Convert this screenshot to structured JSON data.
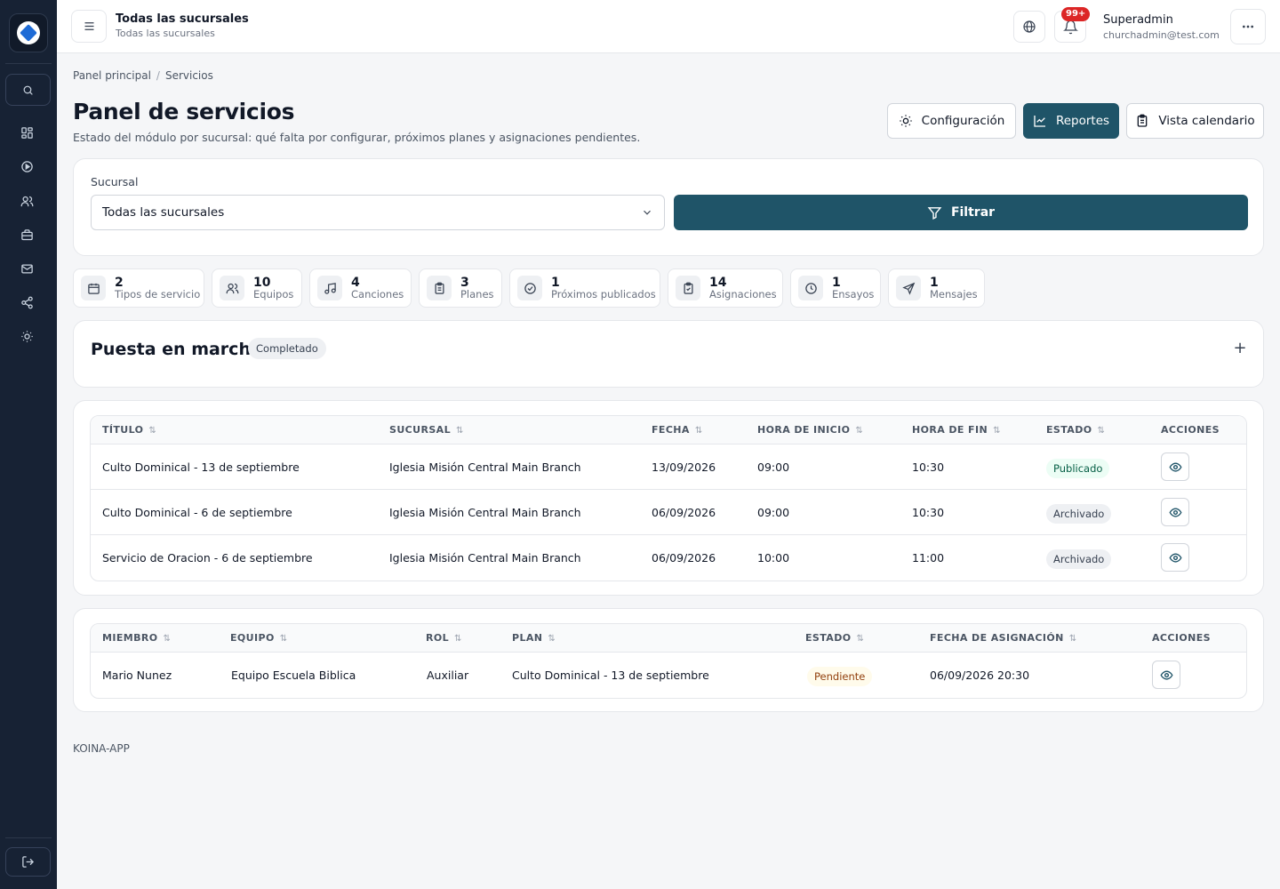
{
  "app": {
    "footer": "KOINA-APP"
  },
  "topbar": {
    "title": "Todas las sucursales",
    "subtitle": "Todas las sucursales",
    "notifications_badge": "99+",
    "user_name": "Superadmin",
    "user_email": "churchadmin@test.com"
  },
  "breadcrumb": {
    "home": "Panel principal",
    "current": "Servicios"
  },
  "header": {
    "title": "Panel de servicios",
    "description": "Estado del módulo por sucursal: qué falta por configurar, próximos planes y asignaciones pendientes.",
    "config_label": "Configuración",
    "reports_label": "Reportes",
    "calendar_label": "Vista calendario"
  },
  "filter": {
    "label": "Sucursal",
    "selected": "Todas las sucursales",
    "button_label": "Filtrar"
  },
  "stats": [
    {
      "value": "2",
      "label": "Tipos de servicio",
      "icon": "calendar-icon"
    },
    {
      "value": "10",
      "label": "Equipos",
      "icon": "users-icon"
    },
    {
      "value": "4",
      "label": "Canciones",
      "icon": "music-icon"
    },
    {
      "value": "3",
      "label": "Planes",
      "icon": "clipboard-icon"
    },
    {
      "value": "1",
      "label": "Próximos publicados",
      "icon": "check-circle-icon"
    },
    {
      "value": "14",
      "label": "Asignaciones",
      "icon": "clipboard-check-icon"
    },
    {
      "value": "1",
      "label": "Ensayos",
      "icon": "clock-icon"
    },
    {
      "value": "1",
      "label": "Mensajes",
      "icon": "send-icon"
    }
  ],
  "setup": {
    "title": "Puesta en marcha",
    "status": "Completado",
    "toggle": "+"
  },
  "plans_table": {
    "columns": [
      "TÍTULO",
      "SUCURSAL",
      "FECHA",
      "HORA DE INICIO",
      "HORA DE FIN",
      "ESTADO",
      "ACCIONES"
    ],
    "rows": [
      {
        "title": "Culto Dominical - 13 de septiembre",
        "branch": "Iglesia Misión Central Main Branch",
        "date": "13/09/2026",
        "start": "09:00",
        "end": "10:30",
        "status": "Publicado"
      },
      {
        "title": "Culto Dominical - 6 de septiembre",
        "branch": "Iglesia Misión Central Main Branch",
        "date": "06/09/2026",
        "start": "09:00",
        "end": "10:30",
        "status": "Archivado"
      },
      {
        "title": "Servicio de Oracion - 6 de septiembre",
        "branch": "Iglesia Misión Central Main Branch",
        "date": "06/09/2026",
        "start": "10:00",
        "end": "11:00",
        "status": "Archivado"
      }
    ]
  },
  "assignments_table": {
    "columns": [
      "MIEMBRO",
      "EQUIPO",
      "ROL",
      "PLAN",
      "ESTADO",
      "FECHA DE ASIGNACIÓN",
      "ACCIONES"
    ],
    "rows": [
      {
        "member": "Mario Nunez",
        "team": "Equipo Escuela Biblica",
        "role": "Auxiliar",
        "plan": "Culto Dominical - 13 de septiembre",
        "status": "Pendiente",
        "assigned": "06/09/2026 20:30"
      }
    ]
  },
  "colors": {
    "sidebar": "#172234",
    "primary": "#1f5468",
    "badge": "#dc2626"
  }
}
